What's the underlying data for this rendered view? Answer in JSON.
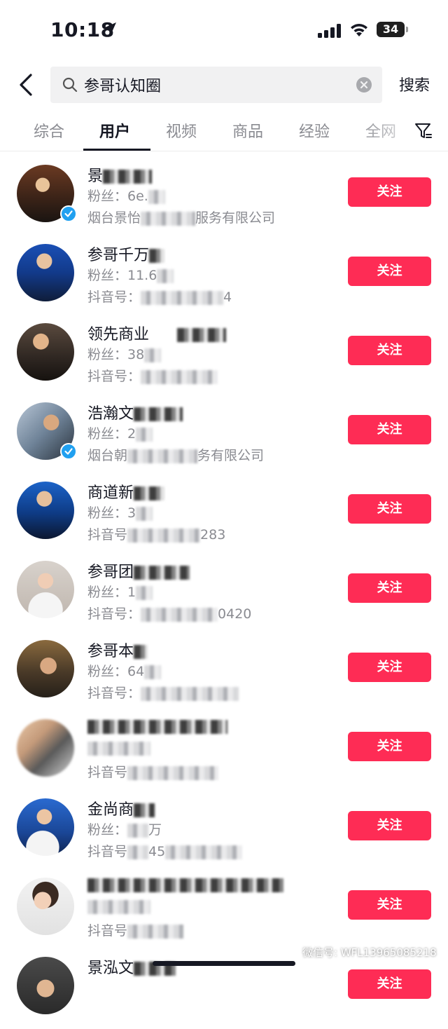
{
  "status_bar": {
    "time": "10:18",
    "battery": "34"
  },
  "search": {
    "query": "参哥认知圈",
    "submit_label": "搜索"
  },
  "tabs": [
    {
      "label": "综合"
    },
    {
      "label": "用户"
    },
    {
      "label": "视频"
    },
    {
      "label": "商品"
    },
    {
      "label": "经验"
    },
    {
      "label": "全网"
    }
  ],
  "active_tab": "用户",
  "follow_label": "关注",
  "users": [
    {
      "name": "景",
      "line2": "粉丝：",
      "line2_tail": "6e.",
      "line3": "烟台景怡",
      "line3_tail": "服务有限公司",
      "verified": true
    },
    {
      "name": "参哥千万",
      "line2": "粉丝：11.6",
      "line2_tail": "",
      "line3": "抖音号：",
      "line3_tail": "4",
      "verified": false
    },
    {
      "name": "领先商业",
      "line2": "粉丝：38",
      "line2_tail": "",
      "line3": "抖音号：",
      "line3_tail": "",
      "verified": false
    },
    {
      "name": "浩瀚文",
      "line2": "粉丝：2",
      "line2_tail": "",
      "line3": "烟台朝",
      "line3_tail": "务有限公司",
      "verified": true
    },
    {
      "name": "商道新",
      "line2": "粉丝：3",
      "line2_tail": "",
      "line3": "抖音号",
      "line3_tail": "283",
      "verified": false
    },
    {
      "name": "参哥团",
      "line2": "粉丝：1",
      "line2_tail": "",
      "line3": "抖音号：",
      "line3_tail": "0420",
      "verified": false
    },
    {
      "name": "参哥本",
      "line2": "粉丝：64",
      "line2_tail": "",
      "line3": "抖音号：",
      "line3_tail": "",
      "verified": false
    },
    {
      "name": "",
      "line2": "",
      "line2_tail": "",
      "line3": "抖音号",
      "line3_tail": "",
      "verified": false
    },
    {
      "name": "金尚商",
      "line2": "粉丝：",
      "line2_tail": "万",
      "line3": "抖音号",
      "line3_tail": "45",
      "verified": false
    },
    {
      "name": "",
      "line2": "",
      "line2_tail": "",
      "line3": "抖音号",
      "line3_tail": "",
      "verified": false
    },
    {
      "name": "景泓文",
      "line2": "",
      "line2_tail": "",
      "line3": "",
      "line3_tail": "",
      "verified": false
    }
  ],
  "watermark": "微信号: WFL13965085218",
  "colors": {
    "accent": "#fe2c55",
    "verified": "#20a0f0"
  }
}
